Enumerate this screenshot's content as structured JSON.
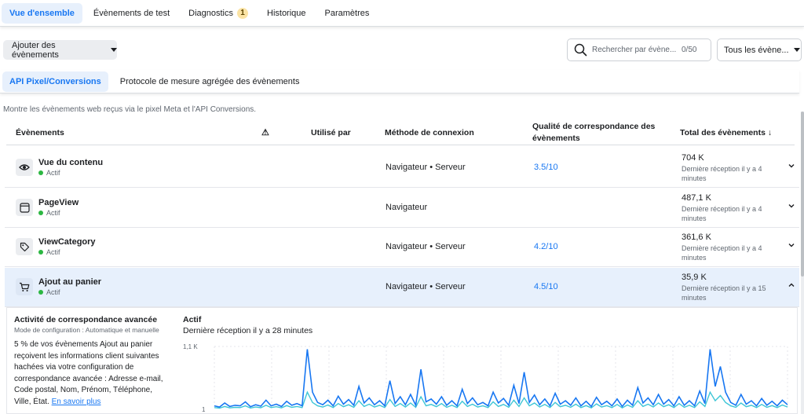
{
  "nav": {
    "tabs": [
      {
        "label": "Vue d'ensemble"
      },
      {
        "label": "Évènements de test"
      },
      {
        "label": "Diagnostics",
        "badge": "1"
      },
      {
        "label": "Historique"
      },
      {
        "label": "Paramètres"
      }
    ]
  },
  "toolbar": {
    "add_events_label": "Ajouter des évènements",
    "search_placeholder": "Rechercher par évène...",
    "search_count": "0/50",
    "filter_label": "Tous les évène..."
  },
  "subtabs": [
    {
      "label": "API Pixel/Conversions"
    },
    {
      "label": "Protocole de mesure agrégée des évènements"
    }
  ],
  "description": "Montre les évènements web reçus via le pixel Meta et l'API Conversions.",
  "table": {
    "headers": {
      "events": "Évènements",
      "warning": "⚠",
      "used_by": "Utilisé par",
      "method": "Méthode de connexion",
      "quality_line1": "Qualité de correspondance des",
      "quality_line2": "évènements",
      "total": "Total des évènements ↓"
    },
    "rows": [
      {
        "name": "Vue du contenu",
        "status": "Actif",
        "method": "Navigateur • Serveur",
        "quality": "3.5/10",
        "total": "704 K",
        "last": "Dernière réception il y a 4 minutes",
        "icon": "eye-icon"
      },
      {
        "name": "PageView",
        "status": "Actif",
        "method": "Navigateur",
        "quality": "",
        "total": "487,1 K",
        "last": "Dernière réception il y a 4 minutes",
        "icon": "browser-window-icon"
      },
      {
        "name": "ViewCategory",
        "status": "Actif",
        "method": "Navigateur • Serveur",
        "quality": "4.2/10",
        "total": "361,6 K",
        "last": "Dernière réception il y a 4 minutes",
        "icon": "tag-icon"
      },
      {
        "name": "Ajout au panier",
        "status": "Actif",
        "method": "Navigateur • Serveur",
        "quality": "4.5/10",
        "total": "35,9 K",
        "last": "Dernière réception il y a 15 minutes",
        "icon": "cart-icon"
      }
    ]
  },
  "detail": {
    "title": "Activité de correspondance avancée",
    "mode": "Mode de configuration : Automatique et manuelle",
    "paragraph": "5 % de vos évènements Ajout au panier reçoivent les informations client suivantes hachées via votre configuration de correspondance avancée : Adresse e-mail, Code postal, Nom, Prénom, Téléphone, Ville, État.",
    "link": "En savoir plus",
    "chart_title": "Actif",
    "chart_subtitle": "Dernière réception il y a 28 minutes"
  },
  "colors": {
    "accent": "#1877f2",
    "active_tab_bg": "#e7f0fc",
    "status_green": "#2cb742",
    "series_dark": "#1877f2",
    "series_light": "#3ec6d6"
  },
  "chart_data": {
    "type": "line",
    "title": "",
    "xlabel": "",
    "ylabel": "",
    "y_tick_labels": [
      "1,1 K",
      "1"
    ],
    "ylim": [
      0,
      1100
    ],
    "series": [
      {
        "values": [
          60,
          40,
          110,
          50,
          70,
          60,
          130,
          45,
          80,
          55,
          160,
          60,
          90,
          50,
          140,
          70,
          100,
          60,
          1050,
          300,
          120,
          80,
          160,
          60,
          230,
          90,
          170,
          70,
          400,
          110,
          200,
          80,
          150,
          60,
          500,
          100,
          220,
          80,
          260,
          70,
          700,
          130,
          180,
          90,
          220,
          70,
          150,
          60,
          350,
          100,
          200,
          80,
          120,
          60,
          300,
          110,
          190,
          70,
          420,
          100,
          650,
          120,
          250,
          80,
          180,
          60,
          280,
          90,
          150,
          70,
          200,
          60,
          140,
          50,
          210,
          80,
          140,
          60,
          180,
          50,
          160,
          70,
          380,
          110,
          200,
          80,
          260,
          90,
          170,
          60,
          220,
          70,
          150,
          60,
          320,
          100,
          1050,
          400,
          750,
          300,
          120,
          70,
          260,
          90,
          150,
          60,
          190,
          70,
          140,
          60,
          160,
          80
        ]
      },
      {
        "values": [
          30,
          20,
          50,
          25,
          35,
          30,
          60,
          22,
          40,
          28,
          70,
          30,
          45,
          25,
          65,
          35,
          50,
          30,
          300,
          120,
          60,
          40,
          75,
          30,
          100,
          45,
          80,
          35,
          150,
          50,
          90,
          40,
          70,
          30,
          170,
          50,
          100,
          40,
          110,
          35,
          220,
          60,
          85,
          45,
          100,
          35,
          70,
          30,
          140,
          50,
          90,
          40,
          60,
          30,
          130,
          50,
          85,
          35,
          160,
          50,
          200,
          60,
          110,
          40,
          85,
          30,
          120,
          45,
          70,
          35,
          90,
          30,
          65,
          25,
          95,
          40,
          65,
          30,
          85,
          25,
          75,
          35,
          150,
          50,
          90,
          40,
          110,
          45,
          80,
          30,
          100,
          35,
          70,
          30,
          130,
          50,
          300,
          150,
          240,
          120,
          60,
          35,
          110,
          45,
          70,
          30,
          85,
          35,
          65,
          30,
          75,
          40
        ]
      }
    ]
  }
}
